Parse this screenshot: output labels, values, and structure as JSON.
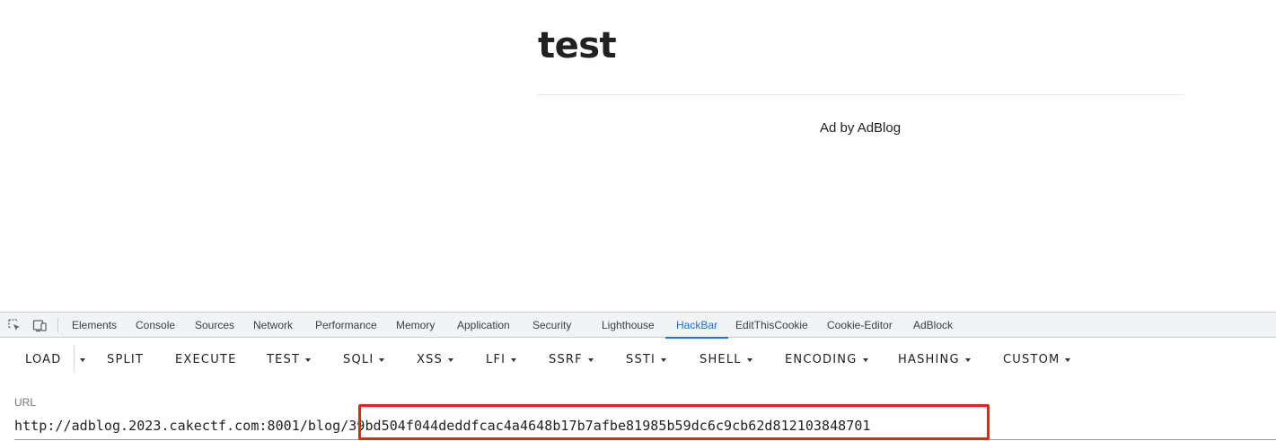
{
  "page": {
    "title": "test",
    "ad_text": "Ad by AdBlog"
  },
  "devtools": {
    "tabs": [
      {
        "label": "Elements"
      },
      {
        "label": "Console"
      },
      {
        "label": "Sources"
      },
      {
        "label": "Network"
      },
      {
        "label": "Performance"
      },
      {
        "label": "Memory"
      },
      {
        "label": "Application"
      },
      {
        "label": "Security"
      },
      {
        "label": "Lighthouse"
      },
      {
        "label": "HackBar",
        "active": true
      },
      {
        "label": "EditThisCookie"
      },
      {
        "label": "Cookie-Editor"
      },
      {
        "label": "AdBlock"
      }
    ],
    "icons": [
      "inspect-element-icon",
      "device-toolbar-icon"
    ],
    "accent_color": "#1a73e8"
  },
  "hackbar": {
    "load": "LOAD",
    "split": "SPLIT",
    "execute": "EXECUTE",
    "menus": [
      "TEST",
      "SQLI",
      "XSS",
      "LFI",
      "SSRF",
      "SSTI",
      "SHELL",
      "ENCODING",
      "HASHING",
      "CUSTOM"
    ],
    "url_label": "URL",
    "url_value": "http://adblog.2023.cakectf.com:8001/blog/39bd504f044deddfcac4a4648b17b7afbe81985b59dc6c9cb62d812103848701",
    "highlight_color": "#e8231c"
  }
}
